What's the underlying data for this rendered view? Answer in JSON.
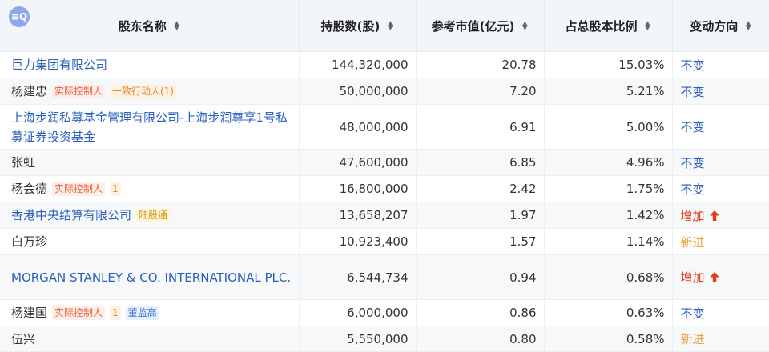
{
  "table": {
    "headers": [
      {
        "label": "股东名称",
        "sort_icon": "sort-icon"
      },
      {
        "label": "持股数(股)",
        "sort_icon": "sort-icon"
      },
      {
        "label": "参考市值(亿元)",
        "sort_icon": "sort-icon"
      },
      {
        "label": "占总股本比例",
        "sort_icon": "sort-icon"
      },
      {
        "label": "变动方向",
        "sort_icon": "sort-icon"
      }
    ],
    "filter_icon_text": "≡Q",
    "rows": [
      {
        "name": "巨力集团有限公司",
        "name_style": "link",
        "tags": [],
        "shares": "144,320,000",
        "value": "20.78",
        "ratio": "15.03%",
        "change": "不变",
        "change_type": "same"
      },
      {
        "name": "杨建忠",
        "name_style": "plain",
        "tags": [
          {
            "text": "实际控制人",
            "color": "red"
          },
          {
            "text": "一致行动人(1)",
            "color": "orange"
          }
        ],
        "shares": "50,000,000",
        "value": "7.20",
        "ratio": "5.21%",
        "change": "不变",
        "change_type": "same"
      },
      {
        "name": "上海步润私募基金管理有限公司-上海步润尊享1号私募证券投资基金",
        "name_style": "link",
        "tags": [],
        "shares": "48,000,000",
        "value": "6.91",
        "ratio": "5.00%",
        "change": "不变",
        "change_type": "same"
      },
      {
        "name": "张虹",
        "name_style": "plain",
        "tags": [],
        "shares": "47,600,000",
        "value": "6.85",
        "ratio": "4.96%",
        "change": "不变",
        "change_type": "same"
      },
      {
        "name": "杨会德",
        "name_style": "plain",
        "tags": [
          {
            "text": "实际控制人",
            "color": "red"
          },
          {
            "text": "1",
            "color": "orange"
          }
        ],
        "shares": "16,800,000",
        "value": "2.42",
        "ratio": "1.75%",
        "change": "不变",
        "change_type": "same"
      },
      {
        "name": "香港中央结算有限公司",
        "name_style": "link",
        "tags": [
          {
            "text": "陆股通",
            "color": "yellow"
          }
        ],
        "shares": "13,658,207",
        "value": "1.97",
        "ratio": "1.42%",
        "change": "增加",
        "change_type": "up"
      },
      {
        "name": "白万珍",
        "name_style": "plain",
        "tags": [],
        "shares": "10,923,400",
        "value": "1.57",
        "ratio": "1.14%",
        "change": "新进",
        "change_type": "new"
      },
      {
        "name": "MORGAN STANLEY & CO. INTERNATIONAL PLC.",
        "name_style": "link",
        "tags": [],
        "shares": "6,544,734",
        "value": "0.94",
        "ratio": "0.68%",
        "change": "增加",
        "change_type": "up"
      },
      {
        "name": "杨建国",
        "name_style": "plain",
        "tags": [
          {
            "text": "实际控制人",
            "color": "red"
          },
          {
            "text": "1",
            "color": "orange"
          },
          {
            "text": "董监高",
            "color": "blue"
          }
        ],
        "shares": "6,000,000",
        "value": "0.86",
        "ratio": "0.63%",
        "change": "不变",
        "change_type": "same"
      },
      {
        "name": "伍兴",
        "name_style": "plain",
        "tags": [],
        "shares": "5,550,000",
        "value": "0.80",
        "ratio": "0.58%",
        "change": "新进",
        "change_type": "new"
      }
    ]
  },
  "colors": {
    "link": "#2b5fbd",
    "increase": "#e23b1e",
    "new_entry": "#e5a23c",
    "header_bg": "#f2f5fa"
  }
}
